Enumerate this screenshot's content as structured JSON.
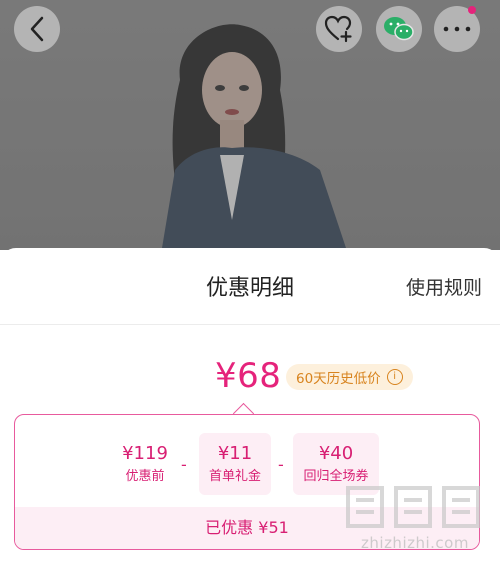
{
  "colors": {
    "accent": "#e5237b",
    "accent_light": "#fdeef5",
    "badge_bg": "#fdf0dc",
    "badge_text": "#d8841f"
  },
  "top_bar": {
    "icons": [
      "chevron-left-icon",
      "heart-plus-icon",
      "wechat-icon",
      "more-icon"
    ]
  },
  "sheet": {
    "title": "优惠明细",
    "rules_link": "使用规则",
    "final_price": "¥68",
    "low_badge": "60天历史低价",
    "breakdown": {
      "items": [
        {
          "value": "¥119",
          "label": "优惠前"
        },
        {
          "value": "¥11",
          "label": "首单礼金"
        },
        {
          "value": "¥40",
          "label": "回归全场券"
        }
      ],
      "operators": [
        "-",
        "-"
      ]
    },
    "saved_text": "已优惠 ¥51"
  },
  "watermark": {
    "text": "zhizhizhi.com"
  }
}
